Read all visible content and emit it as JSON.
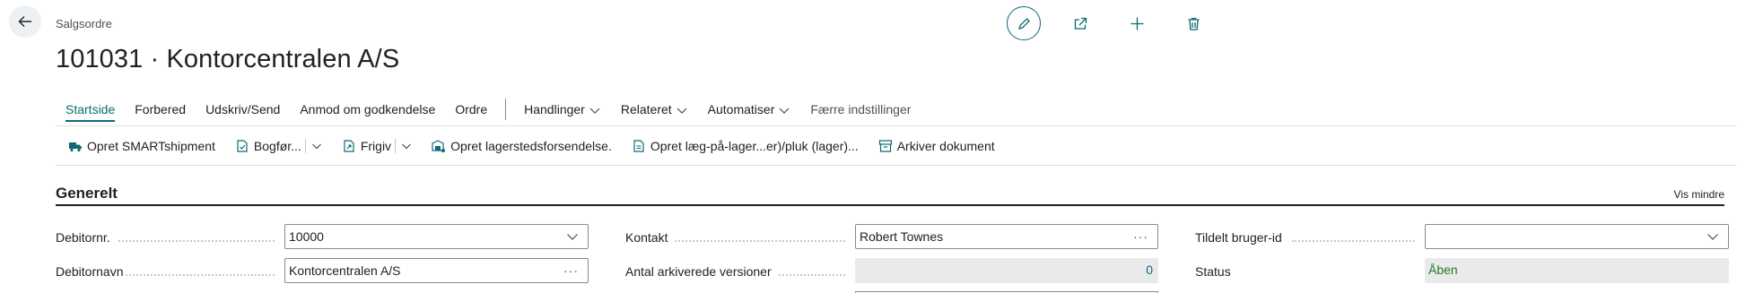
{
  "header": {
    "caption": "Salgsordre",
    "title": "101031 · Kontorcentralen A/S"
  },
  "top_actions": [
    "edit-icon",
    "share-icon",
    "add-icon",
    "delete-icon"
  ],
  "tabs": [
    {
      "label": "Startside"
    },
    {
      "label": "Forbered"
    },
    {
      "label": "Udskriv/Send"
    },
    {
      "label": "Anmod om godkendelse"
    },
    {
      "label": "Ordre"
    },
    {
      "label": "Handlinger"
    },
    {
      "label": "Relateret"
    },
    {
      "label": "Automatiser"
    },
    {
      "label": "Færre indstillinger"
    }
  ],
  "actions": [
    {
      "label": "Opret SMARTshipment",
      "icon": "truck-icon"
    },
    {
      "label": "Bogfør...",
      "icon": "post-icon"
    },
    {
      "label": "Frigiv",
      "icon": "release-icon"
    },
    {
      "label": "Opret lagerstedsforsendelse.",
      "icon": "warehouse-shipment-icon"
    },
    {
      "label": "Opret læg-på-lager...er)/pluk (lager)...",
      "icon": "document-icon"
    },
    {
      "label": "Arkiver dokument",
      "icon": "archive-icon"
    }
  ],
  "section": {
    "title": "Generelt",
    "toggle": "Vis mindre"
  },
  "fields": {
    "debitornr": {
      "label": "Debitornr.",
      "value": "10000"
    },
    "debitornavn": {
      "label": "Debitornavn",
      "value": "Kontorcentralen A/S"
    },
    "kontakt": {
      "label": "Kontakt",
      "value": "Robert Townes"
    },
    "versioner": {
      "label": "Antal arkiverede versioner",
      "value": "0"
    },
    "bruger": {
      "label": "Tildelt bruger-id",
      "value": ""
    },
    "status": {
      "label": "Status",
      "value": "Åben"
    }
  },
  "colors": {
    "accent": "#0b6a75",
    "status": "#2a7a2a"
  }
}
